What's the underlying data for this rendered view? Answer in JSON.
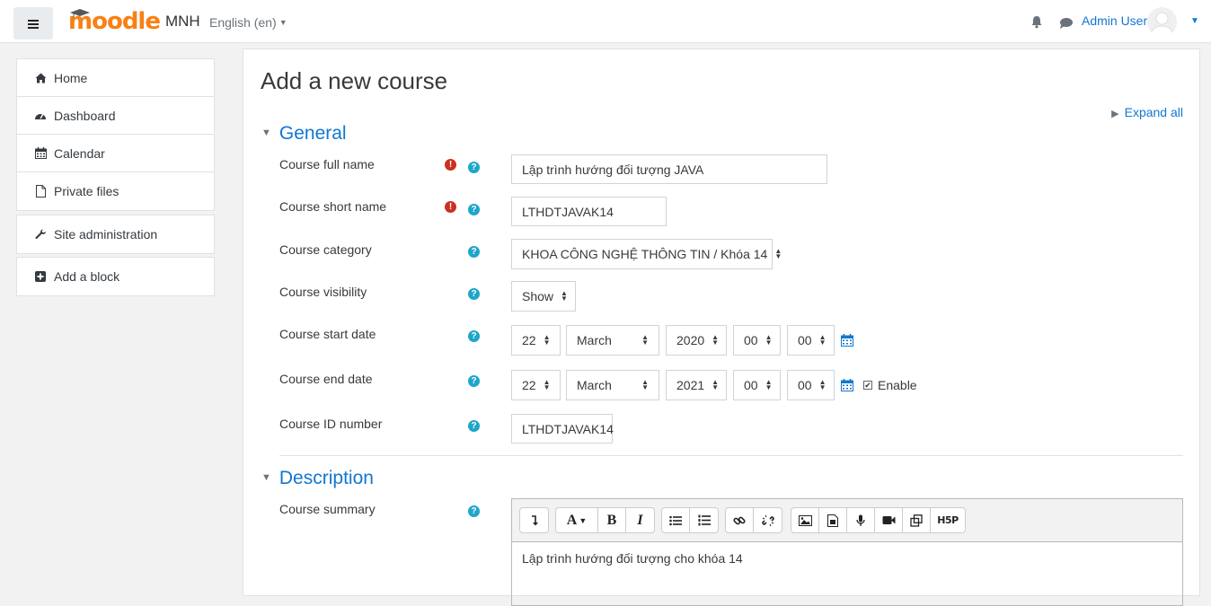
{
  "navbar": {
    "logo_text": "moodle",
    "site_name": "MNH",
    "language": "English (en)",
    "user_name": "Admin User"
  },
  "sidebar": {
    "items": [
      {
        "label": "Home",
        "icon": "home-icon"
      },
      {
        "label": "Dashboard",
        "icon": "dashboard-icon"
      },
      {
        "label": "Calendar",
        "icon": "calendar-icon"
      },
      {
        "label": "Private files",
        "icon": "file-icon"
      }
    ],
    "admin": {
      "label": "Site administration",
      "icon": "wrench-icon"
    },
    "block": {
      "label": "Add a block",
      "icon": "plus-square-icon"
    }
  },
  "main": {
    "title": "Add a new course",
    "expand_all": "Expand all"
  },
  "general": {
    "heading": "General",
    "fullname_label": "Course full name",
    "fullname_value": "Lập trình hướng đối tượng JAVA",
    "shortname_label": "Course short name",
    "shortname_value": "LTHDTJAVAK14",
    "category_label": "Course category",
    "category_value": "KHOA CÔNG NGHỆ THÔNG TIN / Khóa 14",
    "visibility_label": "Course visibility",
    "visibility_value": "Show",
    "startdate_label": "Course start date",
    "start": {
      "day": "22",
      "month": "March",
      "year": "2020",
      "hour": "00",
      "minute": "00"
    },
    "enddate_label": "Course end date",
    "end": {
      "day": "22",
      "month": "March",
      "year": "2021",
      "hour": "00",
      "minute": "00"
    },
    "end_enable_label": "Enable",
    "end_enabled": true,
    "idnumber_label": "Course ID number",
    "idnumber_value": "LTHDTJAVAK14"
  },
  "description": {
    "heading": "Description",
    "summary_label": "Course summary",
    "summary_value": "Lập trình hướng đối tượng cho khóa 14",
    "toolbar": [
      [
        "collapse-toolbar-button"
      ],
      [
        "font-style-button",
        "bold-button",
        "italic-button"
      ],
      [
        "unordered-list-button",
        "ordered-list-button"
      ],
      [
        "link-button",
        "unlink-button"
      ],
      [
        "insert-image-button",
        "insert-media-button",
        "record-audio-button",
        "record-video-button",
        "manage-files-button",
        "h5p-button"
      ]
    ]
  },
  "colors": {
    "link": "#1177d1",
    "brand_orange": "#f98012",
    "required": "#ca3120",
    "help": "#1ea6c9"
  }
}
